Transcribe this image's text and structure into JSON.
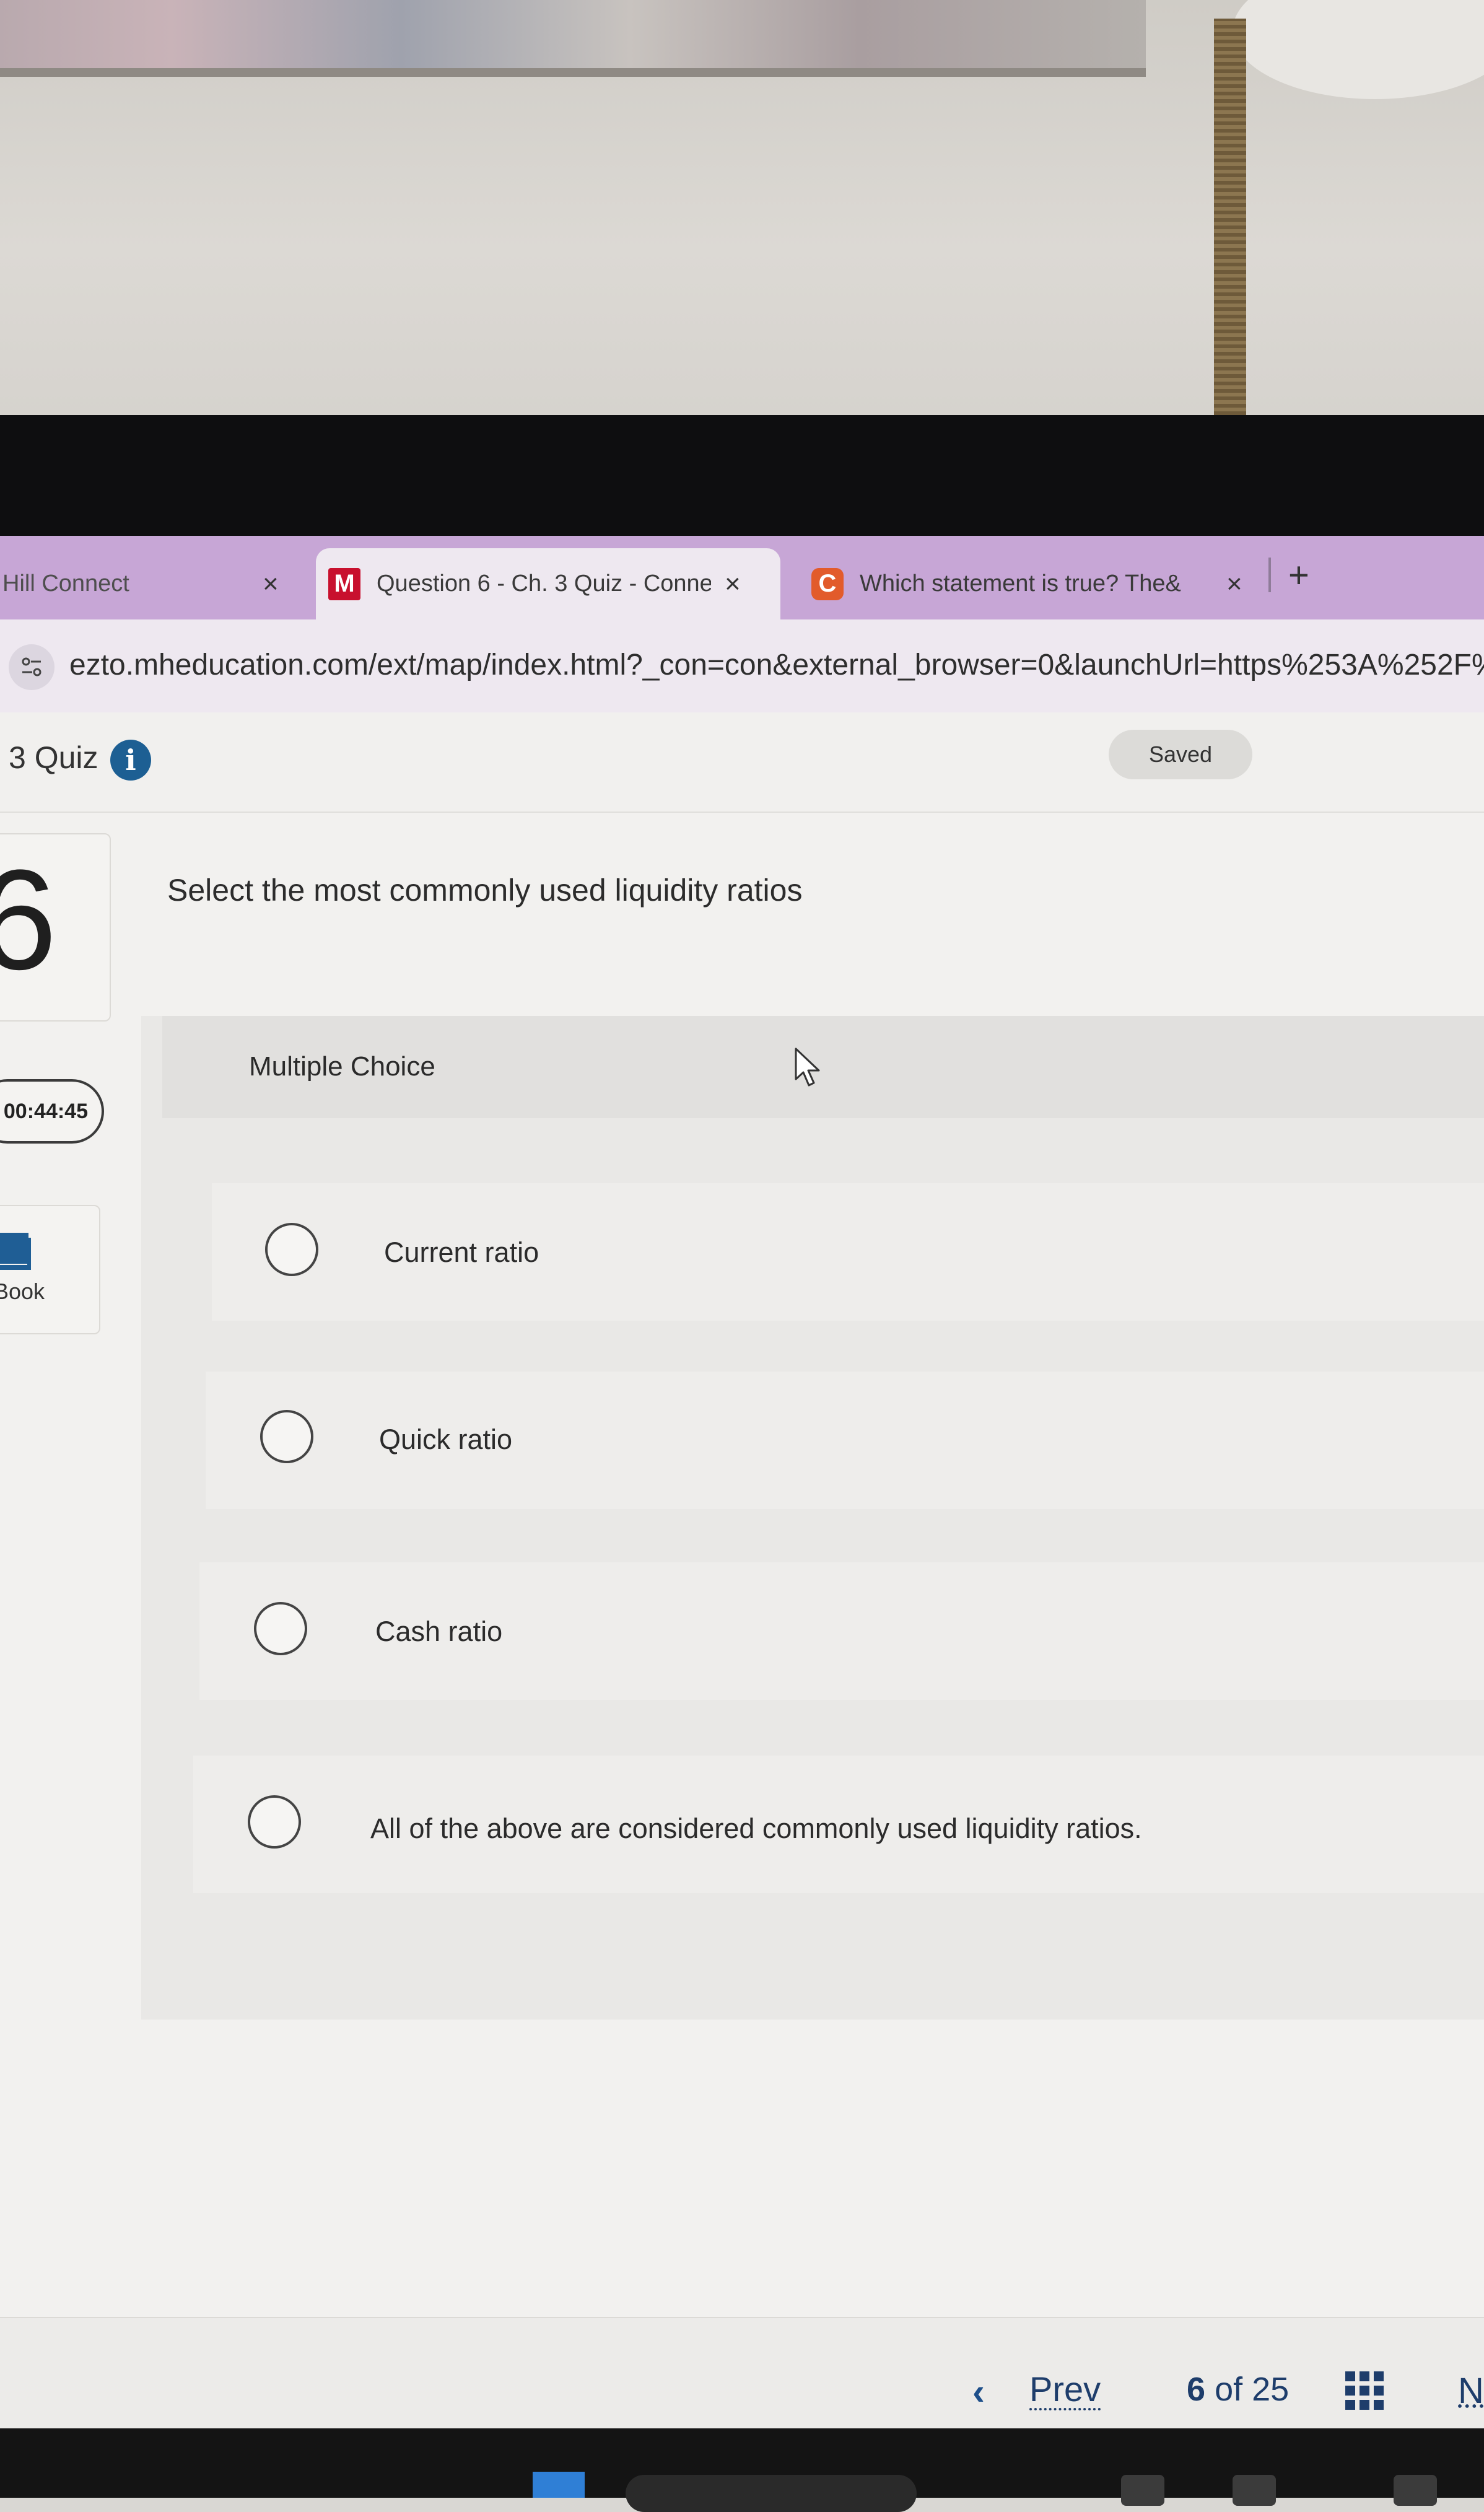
{
  "browser": {
    "tabs": [
      {
        "label": "Hill Connect",
        "favicon": "",
        "active": false
      },
      {
        "label": "Question 6 - Ch. 3 Quiz - Connect",
        "favicon": "M",
        "active": true
      },
      {
        "label": "Which statement is true? The&",
        "favicon": "C",
        "active": false
      }
    ],
    "close_glyph": "×",
    "new_tab_glyph": "+",
    "url": "ezto.mheducation.com/ext/map/index.html?_con=con&external_browser=0&launchUrl=https%253A%252F%252F"
  },
  "quiz": {
    "title": "3 Quiz",
    "info_glyph": "i",
    "saved_label": "Saved",
    "question_number": "6",
    "timer": "00:44:45",
    "ebook_label": "Book"
  },
  "question": {
    "prompt": "Select the most commonly used liquidity ratios",
    "type_label": "Multiple Choice",
    "options": [
      "Current ratio",
      "Quick ratio",
      "Cash ratio",
      "All of the above are considered commonly used liquidity ratios."
    ]
  },
  "navigation": {
    "prev_chevron": "‹",
    "prev_label": "Prev",
    "current_page": "6",
    "of_label": "of",
    "total_pages": "25",
    "next_label": "N"
  },
  "colors": {
    "tabbar": "#c7a6d6",
    "accent_blue": "#1d5f93",
    "link_navy": "#1e3d6b"
  }
}
